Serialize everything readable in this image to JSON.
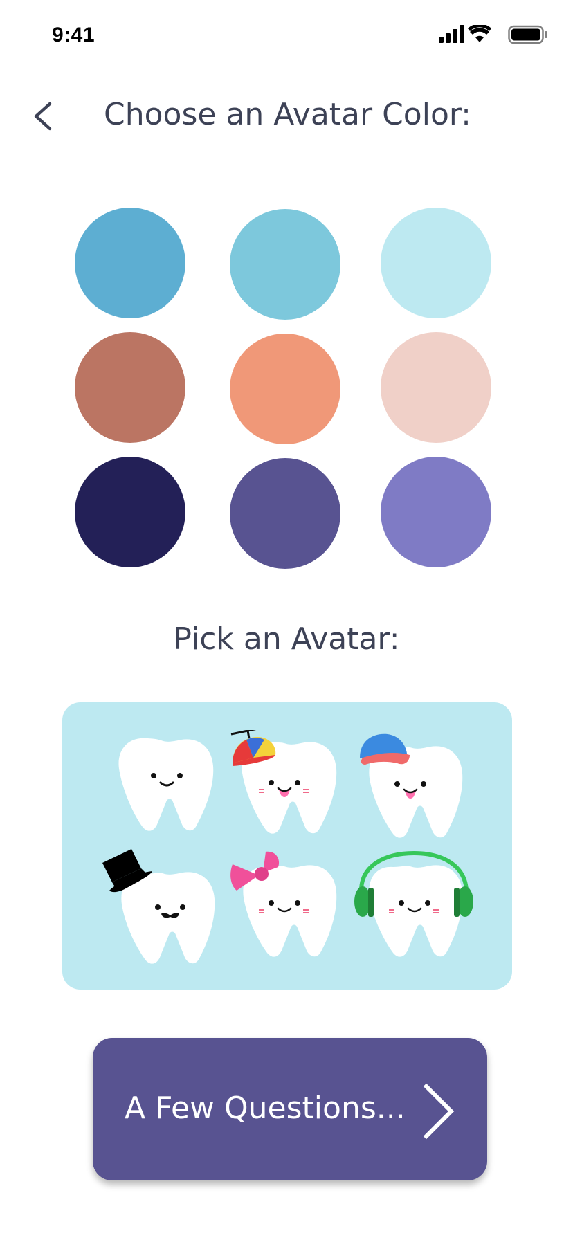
{
  "status_bar": {
    "time": "9:41",
    "icons": [
      "cellular-signal-icon",
      "wifi-icon",
      "battery-icon"
    ]
  },
  "header": {
    "back_icon": "chevron-left-icon",
    "title": "Choose an Avatar Color:"
  },
  "color_options": [
    {
      "name": "blue",
      "color": "#5daed2"
    },
    {
      "name": "teal",
      "color": "#7dc8dc"
    },
    {
      "name": "light-cyan",
      "color": "#bde9f1"
    },
    {
      "name": "brown",
      "color": "#bb7563"
    },
    {
      "name": "salmon",
      "color": "#f09878"
    },
    {
      "name": "pale-peach",
      "color": "#f0d0c8"
    },
    {
      "name": "navy",
      "color": "#232057"
    },
    {
      "name": "indigo",
      "color": "#585391"
    },
    {
      "name": "lavender",
      "color": "#7f7bc5"
    }
  ],
  "avatar_section": {
    "title": "Pick an Avatar:",
    "panel_color": "#bde9f1",
    "avatars": [
      {
        "name": "plain-tooth-avatar",
        "accessory": "none"
      },
      {
        "name": "propeller-cap-tooth-avatar",
        "accessory": "propeller cap"
      },
      {
        "name": "baseball-cap-tooth-avatar",
        "accessory": "baseball cap"
      },
      {
        "name": "top-hat-tooth-avatar",
        "accessory": "top hat and mustache"
      },
      {
        "name": "bow-tooth-avatar",
        "accessory": "pink bow"
      },
      {
        "name": "headphones-tooth-avatar",
        "accessory": "green headphones"
      }
    ]
  },
  "next_button": {
    "label": "A Few Questions...",
    "icon": "chevron-right-icon",
    "color": "#585391"
  }
}
